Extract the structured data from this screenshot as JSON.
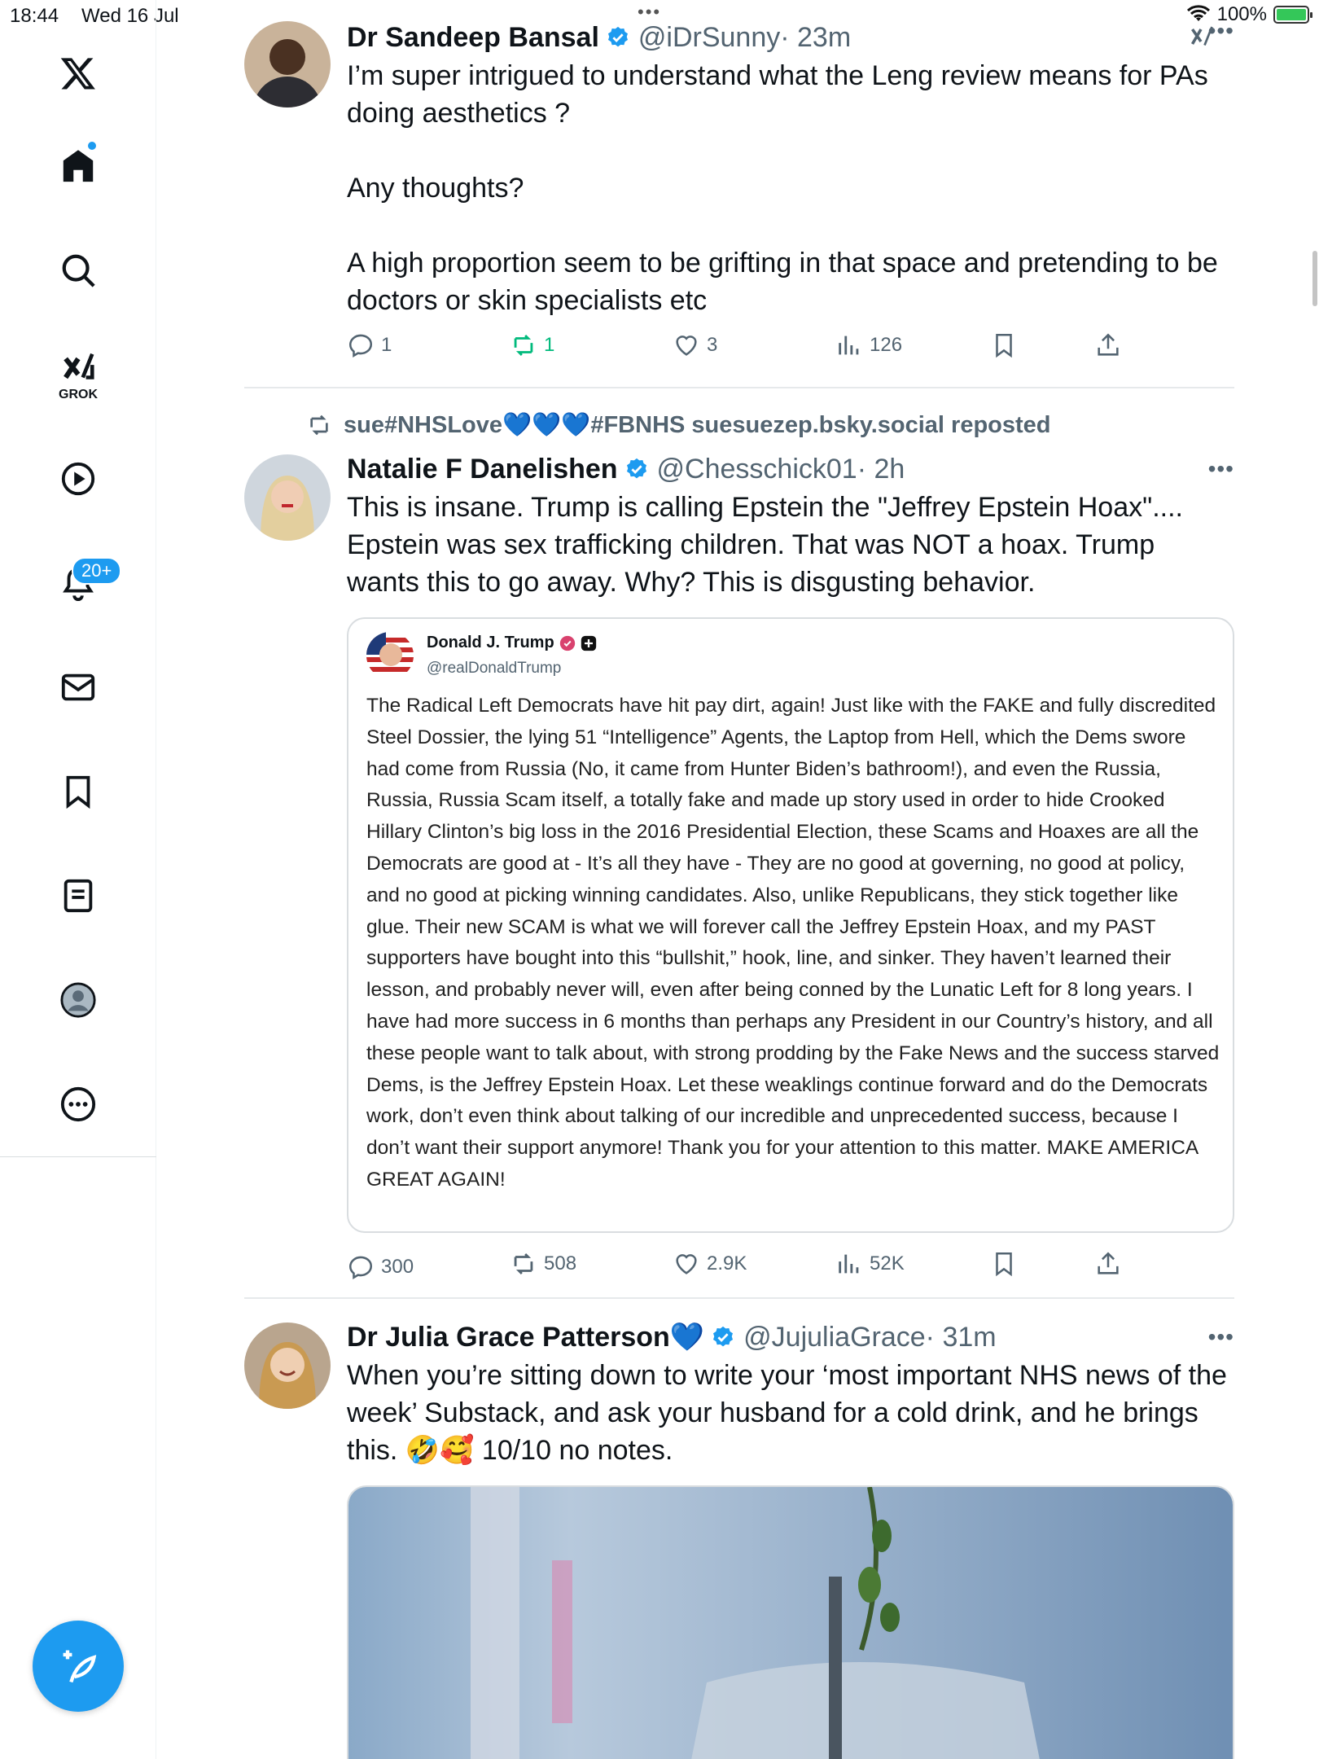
{
  "status_bar": {
    "time": "18:44",
    "date": "Wed 16 Jul",
    "battery": "100%"
  },
  "sidebar": {
    "grok_label": "GROK",
    "notifications_badge": "20+",
    "icons": [
      "x-logo-icon",
      "home-icon",
      "search-icon",
      "grok-icon",
      "video-icon",
      "bell-icon",
      "mail-icon",
      "bookmark-icon",
      "list-icon",
      "profile-icon",
      "more-icon"
    ]
  },
  "tweets": [
    {
      "name": "Dr Sandeep Bansal",
      "handle": "@iDrSunny",
      "time": "· 23m",
      "text": [
        "I’m super intrigued to understand what the Leng review means for PAs doing aesthetics ?",
        "Any thoughts?",
        "A high proportion seem to be grifting in that space and pretending to be doctors or skin specialists etc"
      ],
      "replies": "1",
      "reposts": "1",
      "likes": "3",
      "views": "126"
    },
    {
      "repost_line": "sue#NHSLove💙💙💙#FBNHS suesuezep.bsky.social reposted",
      "name": "Natalie F Danelishen",
      "handle": "@Chesschick01",
      "time": "· 2h",
      "text": [
        "This is insane. Trump is calling Epstein the \"Jeffrey Epstein Hoax\".... Epstein was sex trafficking children. That was NOT a hoax.  Trump wants this to go away. Why? This is disgusting behavior."
      ],
      "quote": {
        "name": "Donald J. Trump",
        "handle": "@realDonaldTrump",
        "text": "The Radical Left Democrats have hit pay dirt, again! Just like with the FAKE and fully discredited Steel Dossier, the lying 51 “Intelligence” Agents, the Laptop from Hell, which the Dems swore had come from Russia (No, it came from Hunter Biden’s bathroom!), and even the Russia, Russia, Russia Scam itself, a totally fake and made up story used in order to hide Crooked Hillary Clinton’s big loss in the 2016 Presidential Election, these Scams and Hoaxes are all the Democrats are good at - It’s all they have - They are no good at governing, no good at policy, and no good at picking winning candidates. Also, unlike Republicans, they stick together like glue. Their new SCAM is what we will forever call the Jeffrey Epstein Hoax, and my PAST supporters have bought into this “bullshit,” hook, line, and sinker. They haven’t learned their lesson, and probably never will, even after being conned by the Lunatic Left for 8 long years. I have had more success in 6 months than perhaps any President in our Country’s history, and all these people want to talk about, with strong prodding by the Fake News and the  success starved Dems, is the Jeffrey Epstein Hoax. Let these weaklings continue forward and do the Democrats work, don’t even think about talking of our incredible and unprecedented success, because I don’t want their support anymore! Thank you for your attention to this matter. MAKE AMERICA GREAT AGAIN!"
      },
      "replies": "300",
      "reposts": "508",
      "likes": "2.9K",
      "views": "52K"
    },
    {
      "name": "Dr Julia Grace Patterson💙",
      "handle": "@JujuliaGrace",
      "time": "· 31m",
      "text": [
        "When you’re sitting down to write your ‘most important NHS news of the week’ Substack, and ask your husband for a cold drink, and he brings this. 🤣🥰 10/10 no notes."
      ]
    }
  ],
  "colors": {
    "accent": "#1d9bf0",
    "repost_green": "#00ba7c",
    "muted": "#536471"
  }
}
